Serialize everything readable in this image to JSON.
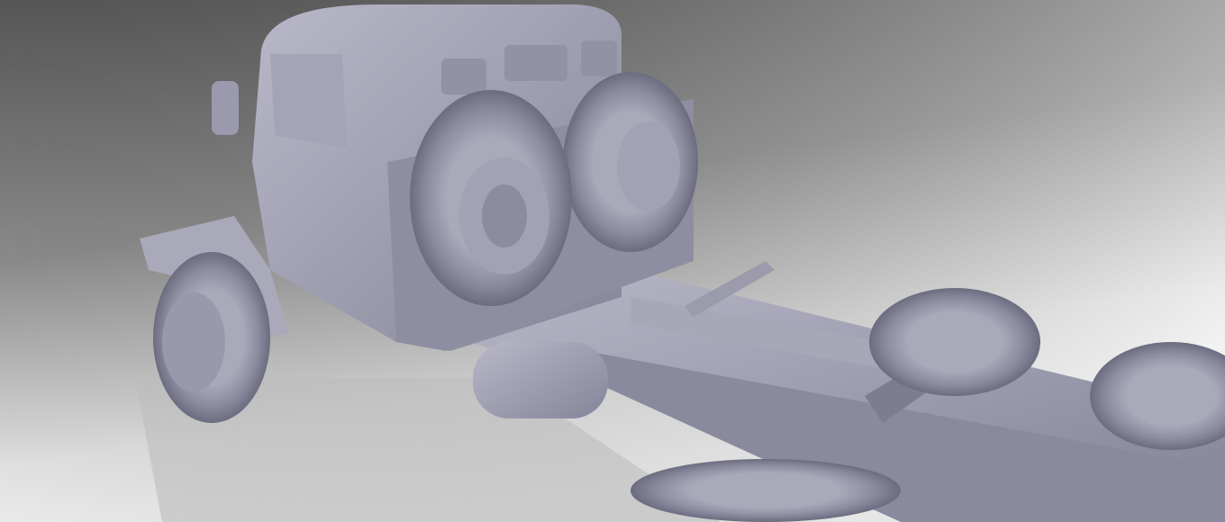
{
  "scene": {
    "subject": "truck-chassis-3d-model",
    "colors": {
      "background_top": "#5a5a5a",
      "background_right": "#b8b8b8",
      "background_bottom": "#f4f4f4",
      "model_base": "#9b9bab",
      "model_light": "#b9b9c8",
      "model_dark": "#5e5e6e",
      "shadow": "#c4c4c4"
    }
  }
}
